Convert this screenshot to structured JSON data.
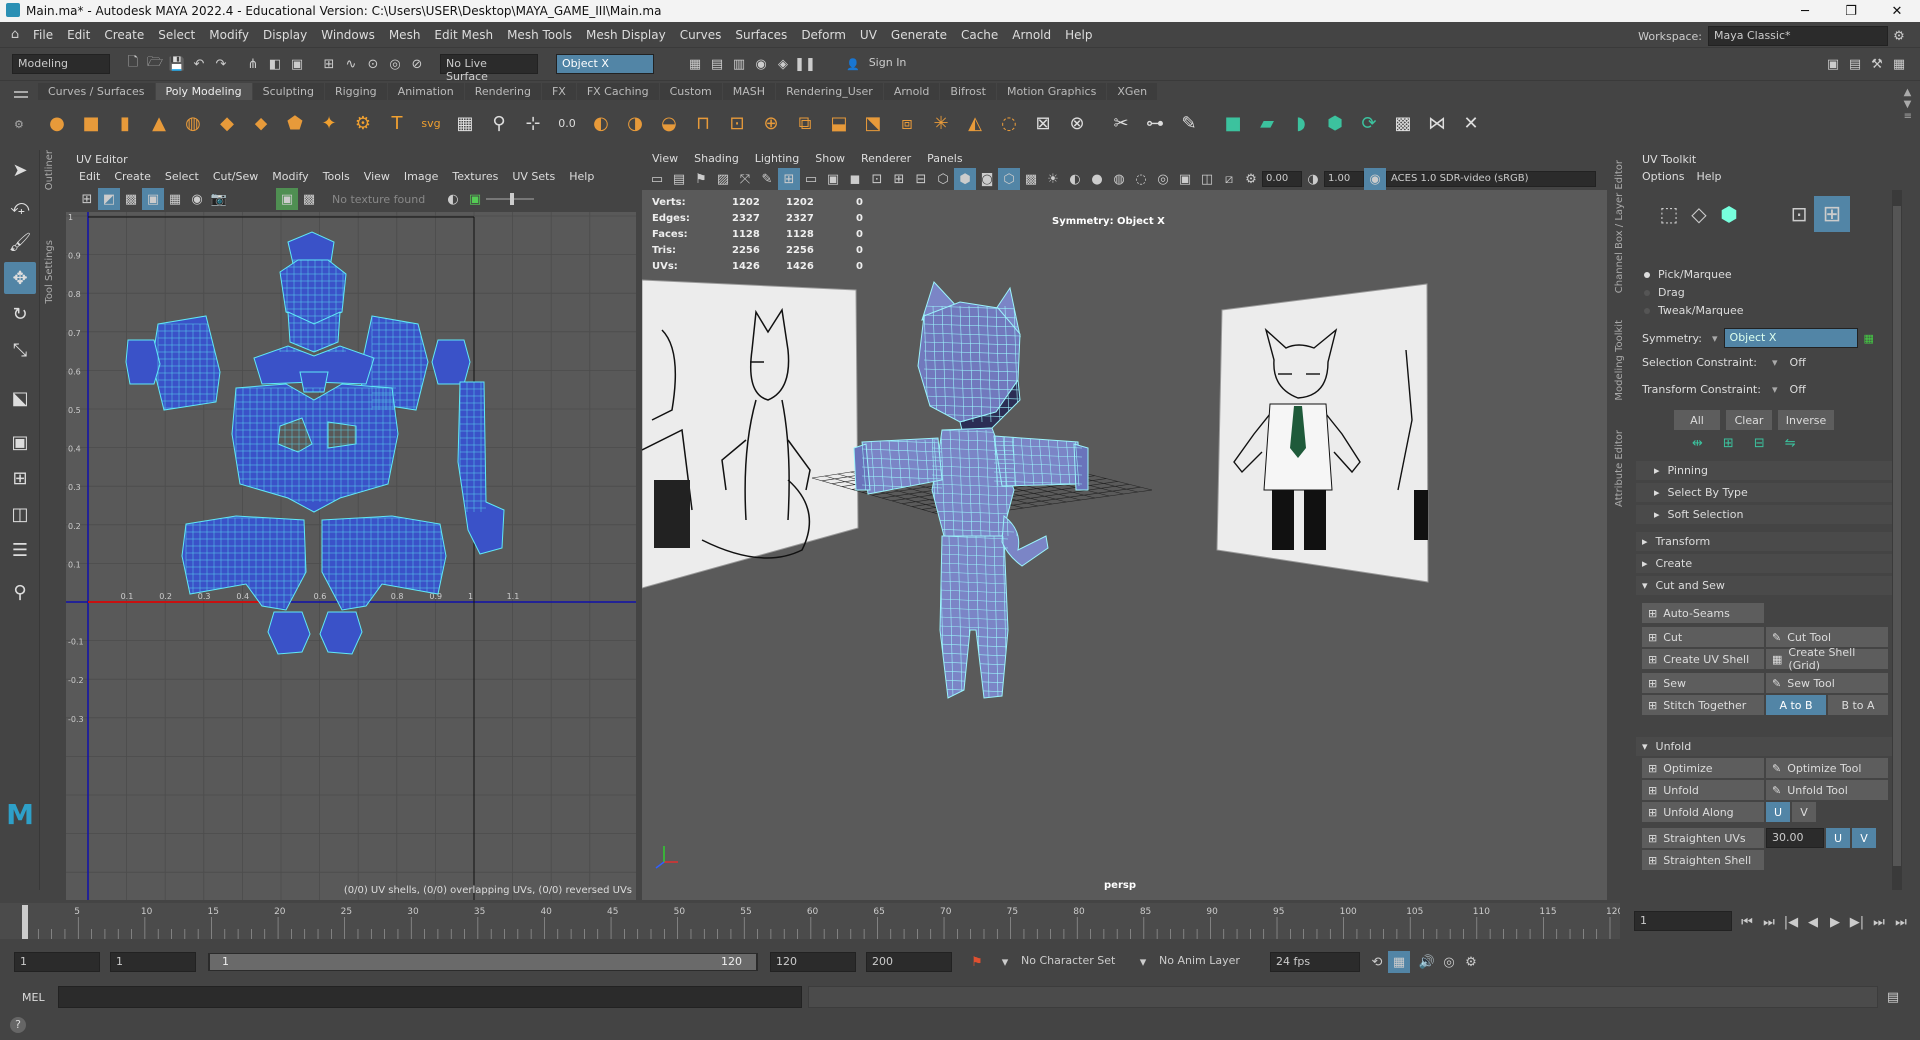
{
  "window": {
    "title": "Main.ma* - Autodesk MAYA 2022.4 - Educational Version: C:\\Users\\USER\\Desktop\\MAYA_GAME_III\\Main.ma",
    "workspace_label": "Workspace:",
    "workspace_value": "Maya Classic*"
  },
  "menus": [
    "File",
    "Edit",
    "Create",
    "Select",
    "Modify",
    "Display",
    "Windows",
    "Mesh",
    "Edit Mesh",
    "Mesh Tools",
    "Mesh Display",
    "Curves",
    "Surfaces",
    "Deform",
    "UV",
    "Generate",
    "Cache",
    "Arnold",
    "Help"
  ],
  "status": {
    "menuset": "Modeling",
    "live_surface": "No Live Surface",
    "symmetry": "Object X",
    "sign_in": "Sign In"
  },
  "shelf_tabs": [
    "Curves / Surfaces",
    "Poly Modeling",
    "Sculpting",
    "Rigging",
    "Animation",
    "Rendering",
    "FX",
    "FX Caching",
    "Custom",
    "MASH",
    "Rendering_User",
    "Arnold",
    "Bifrost",
    "Motion Graphics",
    "XGen"
  ],
  "active_shelf_tab": "Poly Modeling",
  "side_tabs_left": [
    "Outliner",
    "Tool Settings"
  ],
  "side_tabs_right": [
    "Channel Box / Layer Editor",
    "Modeling Toolkit",
    "Attribute Editor"
  ],
  "uv_editor": {
    "title": "UV Editor",
    "menus": [
      "Edit",
      "Create",
      "Select",
      "Cut/Sew",
      "Modify",
      "Tools",
      "View",
      "Image",
      "Textures",
      "UV Sets",
      "Help"
    ],
    "texture": "No texture found",
    "x_ticks": [
      "0.1",
      "0.2",
      "0.3",
      "0.4",
      "0.5",
      "0.6",
      "0.7",
      "0.8",
      "0.9",
      "1",
      "1.1"
    ],
    "y_ticks": [
      "1",
      "0.9",
      "0.8",
      "0.7",
      "0.6",
      "0.5",
      "0.4",
      "0.3",
      "0.2",
      "0.1",
      "-0.1",
      "-0.2",
      "-0.3"
    ],
    "status": "(0/0) UV shells, (0/0) overlapping UVs, (0/0) reversed UVs"
  },
  "viewport": {
    "menus": [
      "View",
      "Shading",
      "Lighting",
      "Show",
      "Renderer",
      "Panels"
    ],
    "near": "0.00",
    "far": "1.00",
    "color_space": "ACES 1.0 SDR-video (sRGB)",
    "hud": [
      {
        "label": "Verts:",
        "a": "1202",
        "b": "1202",
        "c": "0"
      },
      {
        "label": "Edges:",
        "a": "2327",
        "b": "2327",
        "c": "0"
      },
      {
        "label": "Faces:",
        "a": "1128",
        "b": "1128",
        "c": "0"
      },
      {
        "label": "Tris:",
        "a": "2256",
        "b": "2256",
        "c": "0"
      },
      {
        "label": "UVs:",
        "a": "1426",
        "b": "1426",
        "c": "0"
      }
    ],
    "symmetry_hud": "Symmetry: Object X",
    "camera": "persp"
  },
  "uv_toolkit": {
    "title": "UV Toolkit",
    "menus": [
      "Options",
      "Help"
    ],
    "pick_modes": [
      "Pick/Marquee",
      "Drag",
      "Tweak/Marquee"
    ],
    "symmetry_label": "Symmetry:",
    "symmetry_value": "Object X",
    "selection_constraint_label": "Selection Constraint:",
    "selection_constraint_value": "Off",
    "transform_constraint_label": "Transform Constraint:",
    "transform_constraint_value": "Off",
    "select_buttons": [
      "All",
      "Clear",
      "Inverse"
    ],
    "sub_sections": [
      "Pinning",
      "Select By Type",
      "Soft Selection"
    ],
    "sections": [
      "Transform",
      "Create",
      "Cut and Sew",
      "Unfold"
    ],
    "auto_seams": "Auto-Seams",
    "cut": "Cut",
    "cut_tool": "Cut Tool",
    "create_uv_shell": "Create UV Shell",
    "create_shell_grid": "Create Shell (Grid)",
    "sew": "Sew",
    "sew_tool": "Sew Tool",
    "stitch_together": "Stitch Together",
    "a_to_b": "A to B",
    "b_to_a": "B to A",
    "optimize": "Optimize",
    "optimize_tool": "Optimize Tool",
    "unfold": "Unfold",
    "unfold_tool": "Unfold Tool",
    "unfold_along": "Unfold Along",
    "u": "U",
    "v": "V",
    "straighten_uvs": "Straighten UVs",
    "straighten_value": "30.00",
    "straighten_shell": "Straighten Shell"
  },
  "timeline": {
    "ticks": [
      "5",
      "10",
      "15",
      "20",
      "25",
      "30",
      "35",
      "40",
      "45",
      "50",
      "55",
      "60",
      "65",
      "70",
      "75",
      "80",
      "85",
      "90",
      "95",
      "100",
      "105",
      "110",
      "115",
      "120"
    ],
    "current_frame": "1"
  },
  "range": {
    "start": "1",
    "playback_start": "1",
    "slider_start": "1",
    "slider_end": "120",
    "playback_end": "120",
    "end": "200",
    "character_set": "No Character Set",
    "anim_layer": "No Anim Layer",
    "fps": "24 fps"
  },
  "command": {
    "lang": "MEL"
  },
  "colors": {
    "accent": "#5285a6",
    "uv_shell": "#3c55c8",
    "uv_wire": "#47e8f4",
    "mesh": "#7b85c6"
  }
}
